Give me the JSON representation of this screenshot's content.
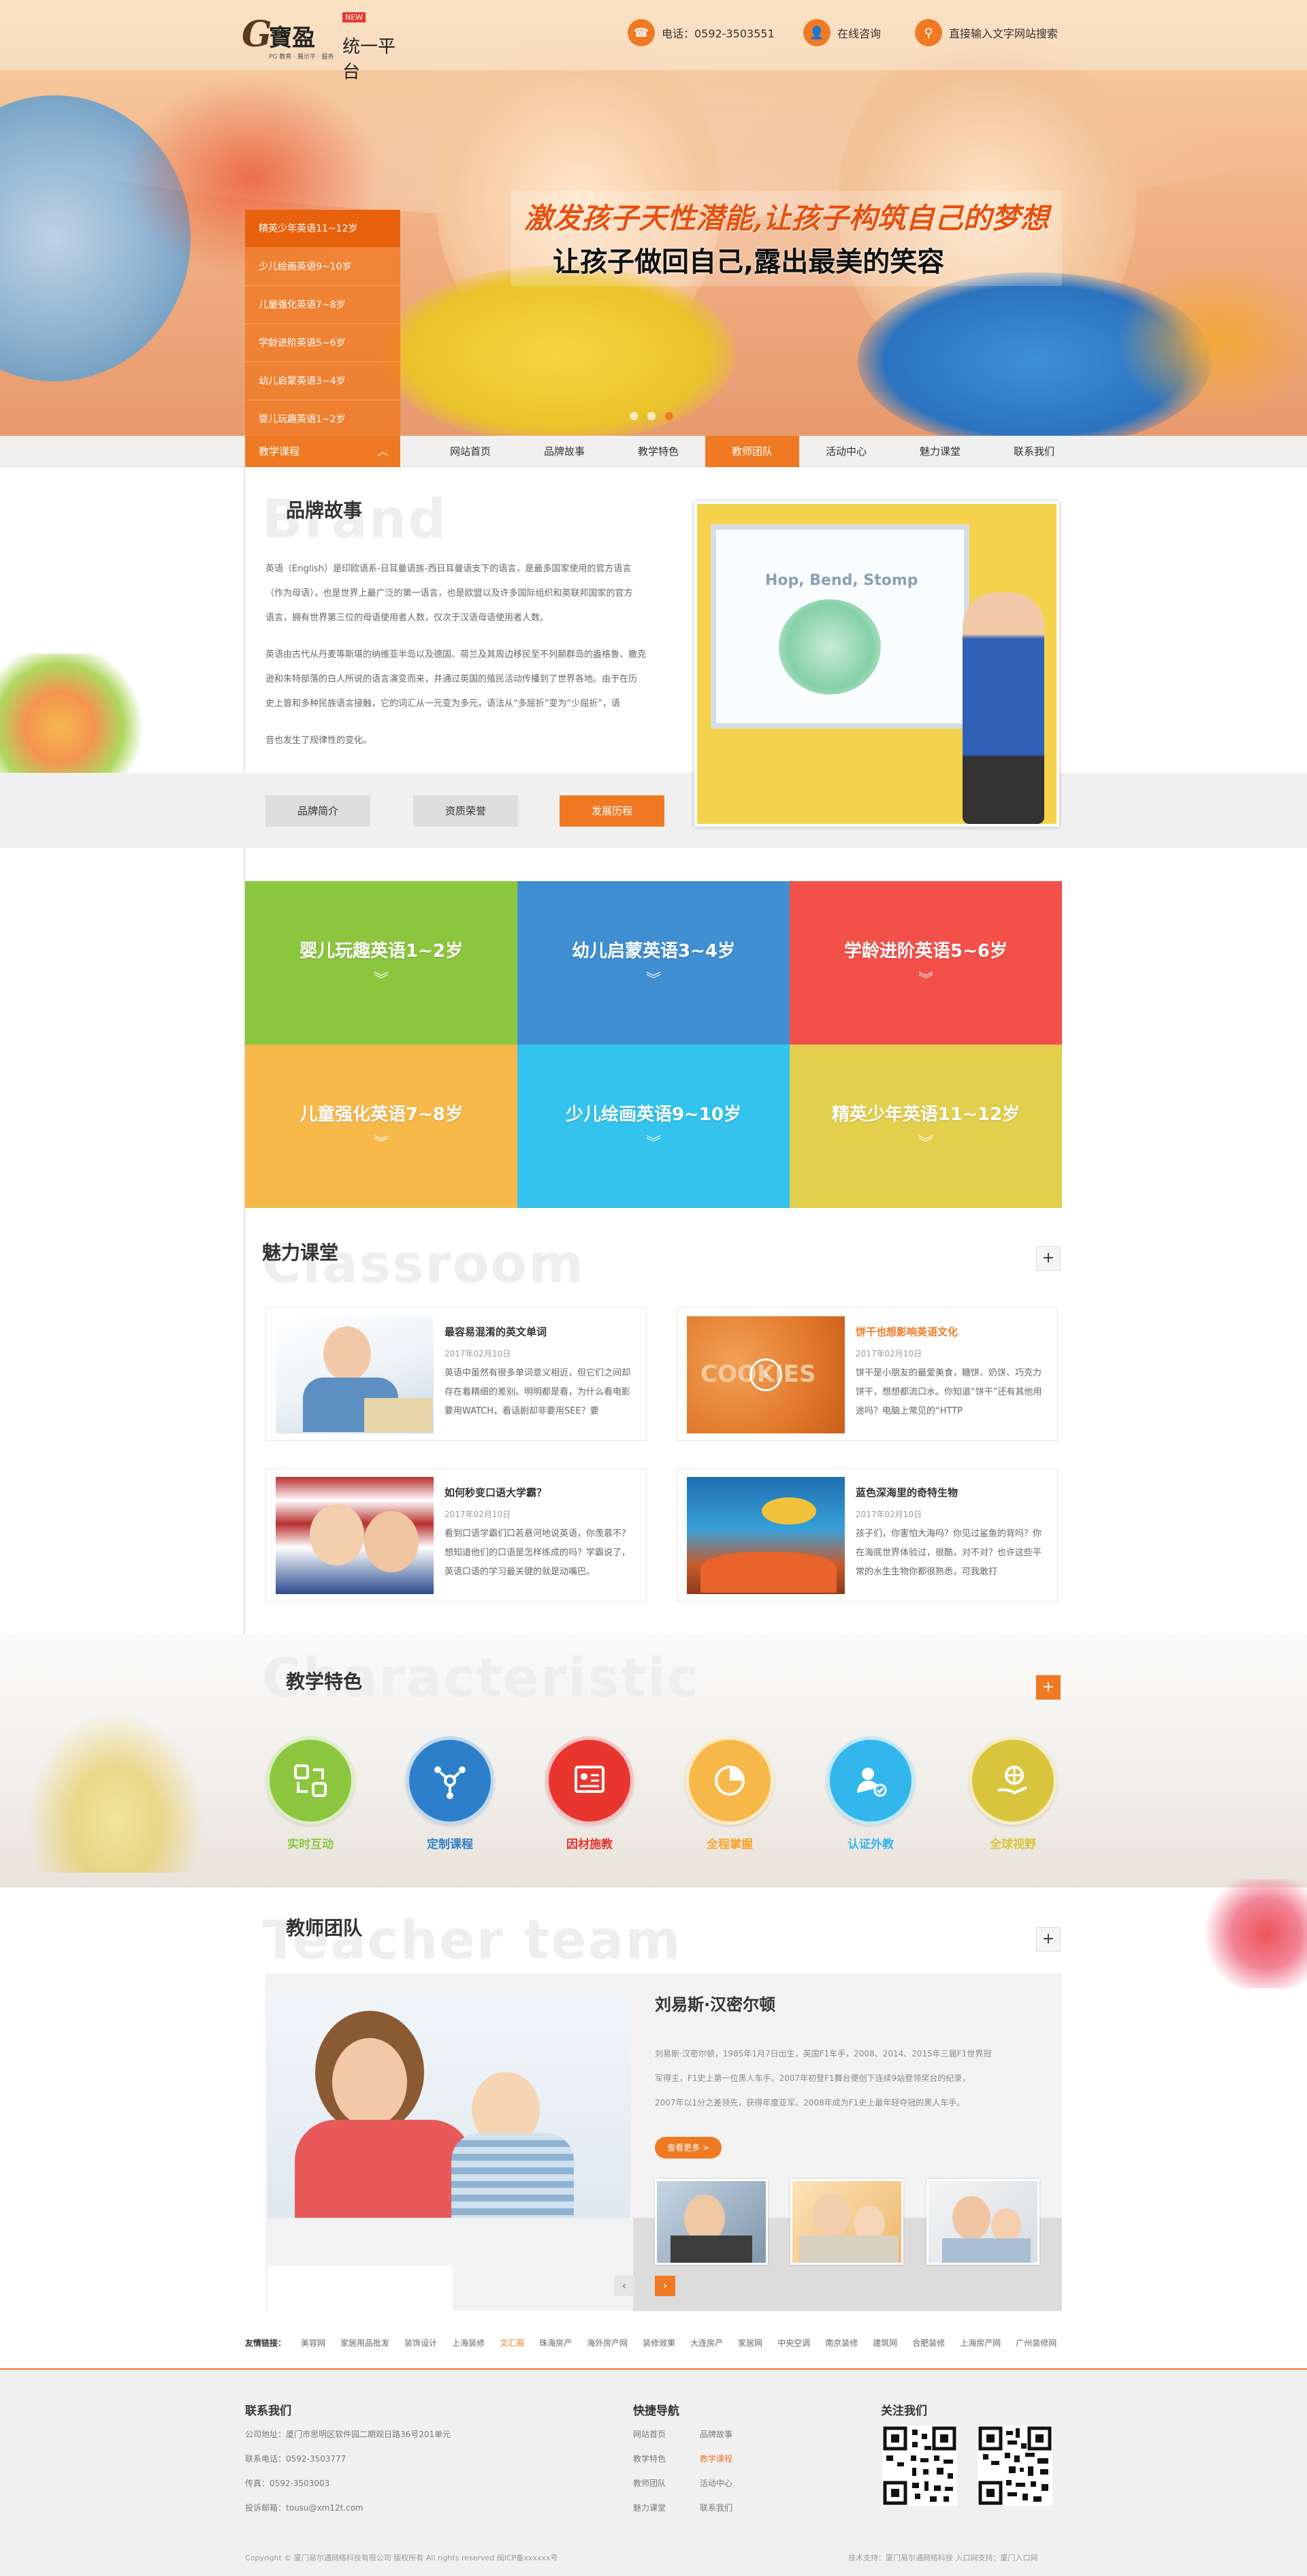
{
  "header": {
    "logo_mark": "G",
    "logo_cn": "寶盈",
    "logo_badge": "NEW",
    "logo_platform": "统一平台",
    "logo_sub": "PG 教育 · 展示平 · 服务",
    "phone": "电话：0592-3503551",
    "consult": "在线咨询",
    "search": "直接输入文字网站搜索"
  },
  "hero": {
    "slogan1": "激发孩子天性潜能,让孩子构筑自己的梦想",
    "slogan2": "让孩子做回自己,露出最美的笑容"
  },
  "side_menu": [
    "精英少年英语11~12岁",
    "少儿绘画英语9~10岁",
    "儿童强化英语7~8岁",
    "学龄进阶英语5~6岁",
    "幼儿启蒙英语3~4岁",
    "婴儿玩趣英语1~2岁"
  ],
  "nav": {
    "category": "教学课程",
    "items": [
      "网站首页",
      "品牌故事",
      "教学特色",
      "教师团队",
      "活动中心",
      "魅力课堂",
      "联系我们"
    ]
  },
  "brand": {
    "title": "品牌故事",
    "bg_word": "Brand",
    "paragraphs": [
      "英语（English）是印欧语系-日耳曼语族-西日耳曼语支下的语言，是最多国家使用的官方语言",
      "（作为母语），也是世界上最广泛的第一语言，也是欧盟以及许多国际组织和英联邦国家的官方",
      "语言，拥有世界第三位的母语使用者人数，仅次于汉语母语使用者人数。",
      "英语由古代从丹麦等斯堪的纳维亚半岛以及德国、荷兰及其周边移民至不列颠群岛的盎格鲁、撒克",
      "逊和朱特部落的白人所说的语言演变而来，并通过英国的殖民活动传播到了世界各地。由于在历",
      "史上曾和多种民族语言接触，它的词汇从一元变为多元，语法从“多屈折”变为“少屈折”，语",
      "音也发生了规律性的变化。"
    ],
    "buttons": [
      "品牌简介",
      "资质荣誉",
      "发展历程"
    ],
    "board_text": "Hop, Bend, Stomp"
  },
  "courses": [
    {
      "label": "婴儿玩趣英语1~2岁",
      "color": "#8cc63f"
    },
    {
      "label": "幼儿启蒙英语3~4岁",
      "color": "#3f8fd2"
    },
    {
      "label": "学龄进阶英语5~6岁",
      "color": "#f4504a"
    },
    {
      "label": "儿童强化英语7~8岁",
      "color": "#f7b84a"
    },
    {
      "label": "少儿绘画英语9~10岁",
      "color": "#33c3ec"
    },
    {
      "label": "精英少年英语11~12岁",
      "color": "#e2cf4c"
    }
  ],
  "classroom": {
    "title": "魅力课堂",
    "bg_word": "Classroom",
    "cards": [
      {
        "title": "最容易混淆的英文单词",
        "date": "2017年02月10日",
        "text": "英语中虽然有很多单词意义相近，但它们之间却存在着精细的差别。明明都是看，为什么看电影要用WATCH，看话剧却非要用SEE？要"
      },
      {
        "title": "饼干也想影响英语文化",
        "date": "2017年02月10日",
        "text": "饼干是小朋友的最爱美食，糖饼、奶饼、巧克力饼干，想想都流口水。你知道“饼干”还有其他用途吗？电脑上常见的“HTTP"
      },
      {
        "title": "如何秒变口语大学霸？",
        "date": "2017年02月10日",
        "text": "看到口语学霸们口若悬河地说英语，你羡慕不？想知道他们的口语是怎样练成的吗？学霸说了，英语口语的学习最关键的就是动嘴巴。"
      },
      {
        "title": "蓝色深海里的奇特生物",
        "date": "2017年02月10日",
        "text": "孩子们，你害怕大海吗？你见过鲨鱼的背吗？你在海底世界体验过，很酷，对不对？也许这些平常的水生生物你都很熟悉，可我敢打"
      }
    ]
  },
  "characteristic": {
    "title": "教学特色",
    "bg_word": "Characteristic",
    "features": [
      {
        "label": "实时互动",
        "color": "#8cc63f",
        "icon": "interaction-icon"
      },
      {
        "label": "定制课程",
        "color": "#2e7fc9",
        "icon": "custom-course-icon"
      },
      {
        "label": "因材施教",
        "color": "#e8362f",
        "icon": "tailored-teaching-icon"
      },
      {
        "label": "全程掌握",
        "color": "#f7b84a",
        "icon": "progress-chart-icon"
      },
      {
        "label": "认证外教",
        "color": "#33b6ec",
        "icon": "certified-teacher-icon"
      },
      {
        "label": "全球视野",
        "color": "#d9c43e",
        "icon": "global-vision-icon"
      }
    ]
  },
  "teacher": {
    "title": "教师团队",
    "bg_word": "Teacher team",
    "name": "刘易斯·汉密尔顿",
    "bio": [
      "刘易斯·汉密尔顿，1985年1月7日出生，英国F1车手，2008、2014、2015年三届F1世界冠",
      "军得主，F1史上第一位黑人车手。2007年初登F1舞台便创下连续9站登领奖台的纪录，",
      "2007年以1分之差领先，获得年度亚军。2008年成为F1史上最年轻夺冠的黑人车手。"
    ],
    "more": "查看更多 >"
  },
  "links": {
    "heading": "友情链接：",
    "items": [
      "美容网",
      "家居用品批发",
      "装饰设计",
      "上海装修",
      "文汇阁",
      "珠海房产",
      "海外房产网",
      "装修效果",
      "大连房产",
      "家居网",
      "中央空调",
      "南京装修",
      "建筑网",
      "合肥装修",
      "上海房产网",
      "广州装修网"
    ]
  },
  "footer": {
    "contact_title": "联系我们",
    "contact_lines": [
      "公司地址：厦门市思明区软件园二期观日路36号201单元",
      "联系电话：0592-3503777",
      "传真：0592-3503003",
      "投诉邮箱：tousu@xm12t.com"
    ],
    "quick_title": "快捷导航",
    "quick_col1": [
      "网站首页",
      "教学特色",
      "教师团队",
      "魅力课堂"
    ],
    "quick_col2": [
      "品牌故事",
      "教学课程",
      "活动中心",
      "联系我们"
    ],
    "follow_title": "关注我们",
    "copyright": "Copyright © 厦门易尔通网络科技有限公司 版权所有 All rights reserved  闽ICP备xxxxxx号",
    "support": "技术支持：厦门易尔通网络科技    入口网支持：厦门入口网"
  }
}
